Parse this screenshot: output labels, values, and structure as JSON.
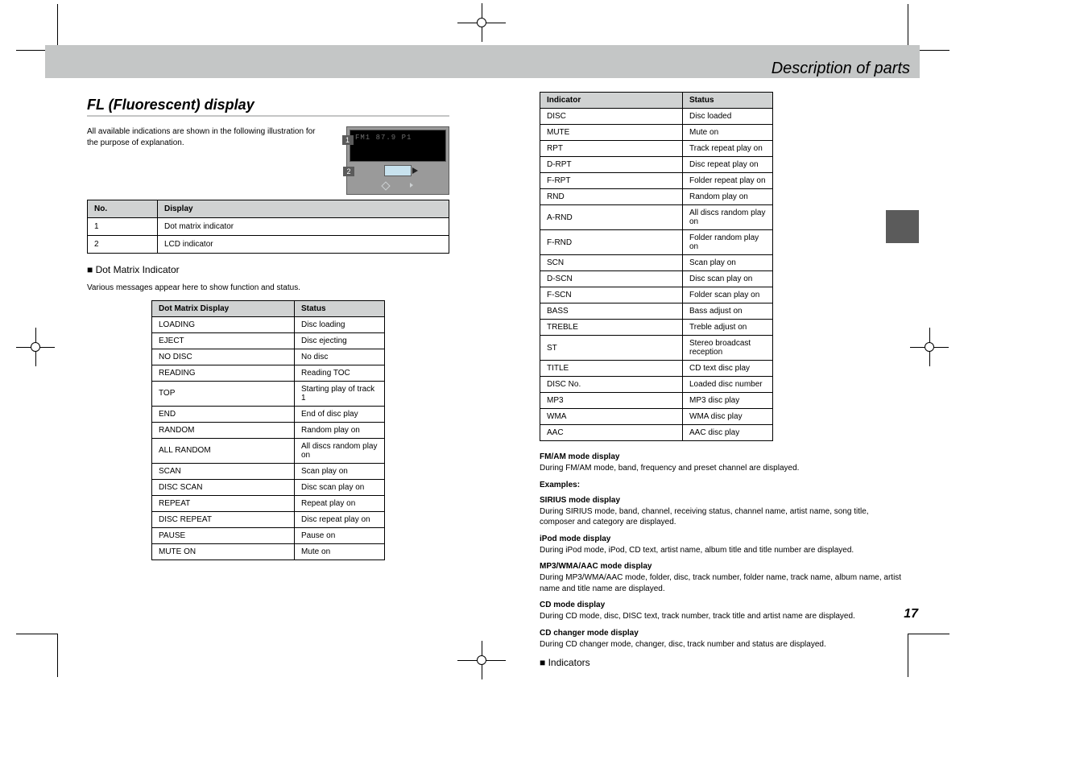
{
  "header": {
    "title": "Description of parts"
  },
  "section": {
    "heading": "FL (Fluorescent) display",
    "intro": "All available indications are shown in the following illustration for the purpose of explanation.",
    "panel_rows": [
      {
        "no": "1",
        "desc": "Dot matrix indicator"
      },
      {
        "no": "2",
        "desc": "LCD indicator"
      }
    ],
    "panel_table_headers": {
      "no": "No.",
      "desc": "Display"
    },
    "sub_heading": "■ Dot Matrix Indicator",
    "sub_intro": "Various messages appear here to show function and status.",
    "display1_title": "FM/AM mode display",
    "display1_text": "During FM/AM mode, band, frequency and preset channel are displayed.",
    "examples_title": "Examples:",
    "display2_title": "SIRIUS mode display",
    "display2_text": "During SIRIUS mode, band, channel, receiving status, channel name, artist name, song title, composer and category are displayed.",
    "display3_title": "iPod mode display",
    "display3_text": "During iPod mode, iPod, CD text, artist name, album title and title number are displayed.",
    "display4_title": "MP3/WMA/AAC mode display",
    "display4_text": "During MP3/WMA/AAC mode, folder, disc, track number, folder name, track name, album name, artist name and title name are displayed.",
    "display5_title": "CD mode display",
    "display5_text": "During CD mode, disc, DISC text, track number, track title and artist name are displayed.",
    "display6_title": "CD changer mode display",
    "display6_text": "During CD changer mode, changer, disc, track number and status are displayed.",
    "indicators_title": "■ Indicators"
  },
  "dot_matrix_table": {
    "headers": {
      "msg": "Dot Matrix Display",
      "status": "Status"
    },
    "rows": [
      {
        "msg": "LOADING",
        "status": "Disc loading"
      },
      {
        "msg": "EJECT",
        "status": "Disc ejecting"
      },
      {
        "msg": "NO DISC",
        "status": "No disc"
      },
      {
        "msg": "READING",
        "status": "Reading TOC"
      },
      {
        "msg": "TOP",
        "status": "Starting play of track 1"
      },
      {
        "msg": "END",
        "status": "End of disc play"
      },
      {
        "msg": "RANDOM",
        "status": "Random play on"
      },
      {
        "msg": "ALL RANDOM",
        "status": "All discs random play on"
      },
      {
        "msg": "SCAN",
        "status": "Scan play on"
      },
      {
        "msg": "DISC SCAN",
        "status": "Disc scan play on"
      },
      {
        "msg": "REPEAT",
        "status": "Repeat play on"
      },
      {
        "msg": "DISC REPEAT",
        "status": "Disc repeat play on"
      },
      {
        "msg": "PAUSE",
        "status": "Pause on"
      },
      {
        "msg": "MUTE ON",
        "status": "Mute on"
      }
    ]
  },
  "indicator_table": {
    "headers": {
      "indicator": "Indicator",
      "status": "Status"
    },
    "rows": [
      {
        "indicator": "DISC",
        "status": "Disc loaded"
      },
      {
        "indicator": "MUTE",
        "status": "Mute on"
      },
      {
        "indicator": "RPT",
        "status": "Track repeat play on"
      },
      {
        "indicator": "D-RPT",
        "status": "Disc repeat play on"
      },
      {
        "indicator": "F-RPT",
        "status": "Folder repeat play on"
      },
      {
        "indicator": "RND",
        "status": "Random play on"
      },
      {
        "indicator": "A-RND",
        "status": "All discs random play on"
      },
      {
        "indicator": "F-RND",
        "status": "Folder random play on"
      },
      {
        "indicator": "SCN",
        "status": "Scan play on"
      },
      {
        "indicator": "D-SCN",
        "status": "Disc scan play on"
      },
      {
        "indicator": "F-SCN",
        "status": "Folder scan play on"
      },
      {
        "indicator": "BASS",
        "status": "Bass adjust on"
      },
      {
        "indicator": "TREBLE",
        "status": "Treble adjust on"
      },
      {
        "indicator": "ST",
        "status": "Stereo broadcast reception"
      },
      {
        "indicator": "TITLE",
        "status": "CD text disc play"
      },
      {
        "indicator": "DISC No.",
        "status": "Loaded disc number"
      },
      {
        "indicator": "MP3",
        "status": "MP3 disc play"
      },
      {
        "indicator": "WMA",
        "status": "WMA disc play"
      },
      {
        "indicator": "AAC",
        "status": "AAC disc play"
      }
    ]
  },
  "page_number": "17",
  "diagram_labels": {
    "one": "1",
    "two": "2",
    "dot_preview": "FM1  87.9  P1"
  }
}
